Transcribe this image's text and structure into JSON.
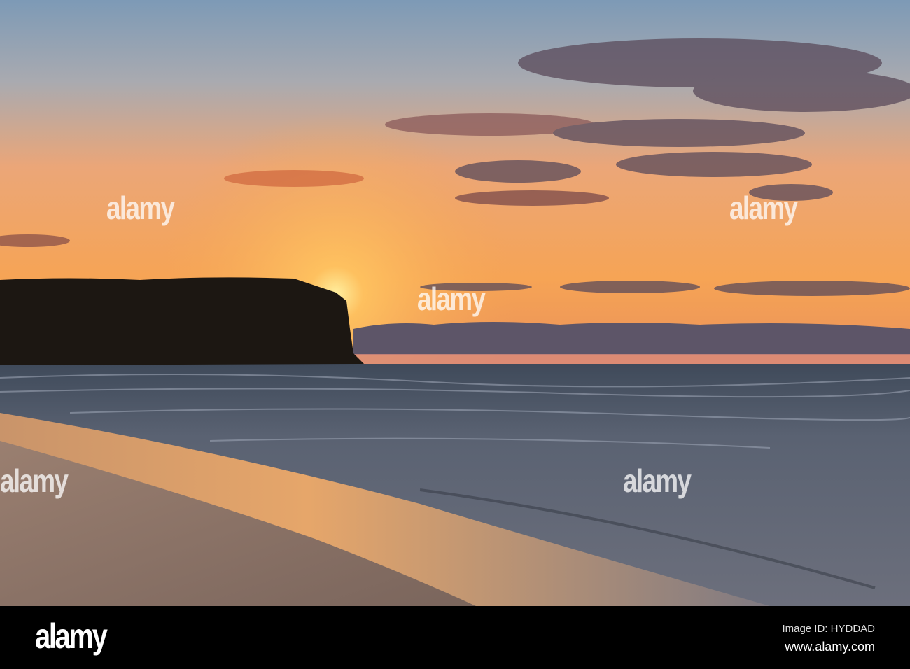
{
  "image": {
    "subject": "sunset-over-beach-and-headland",
    "colors": {
      "sky_top": "#7f9bb5",
      "sky_glow": "#f5a050",
      "sun": "#ffe07a",
      "headland": "#1a1612",
      "sea": "#5f6878",
      "sand": "#8a7466"
    }
  },
  "watermark": {
    "text": "alamy"
  },
  "footer": {
    "logo": "alamy",
    "image_id": "Image ID: HYDDAD",
    "website": "www.alamy.com"
  }
}
